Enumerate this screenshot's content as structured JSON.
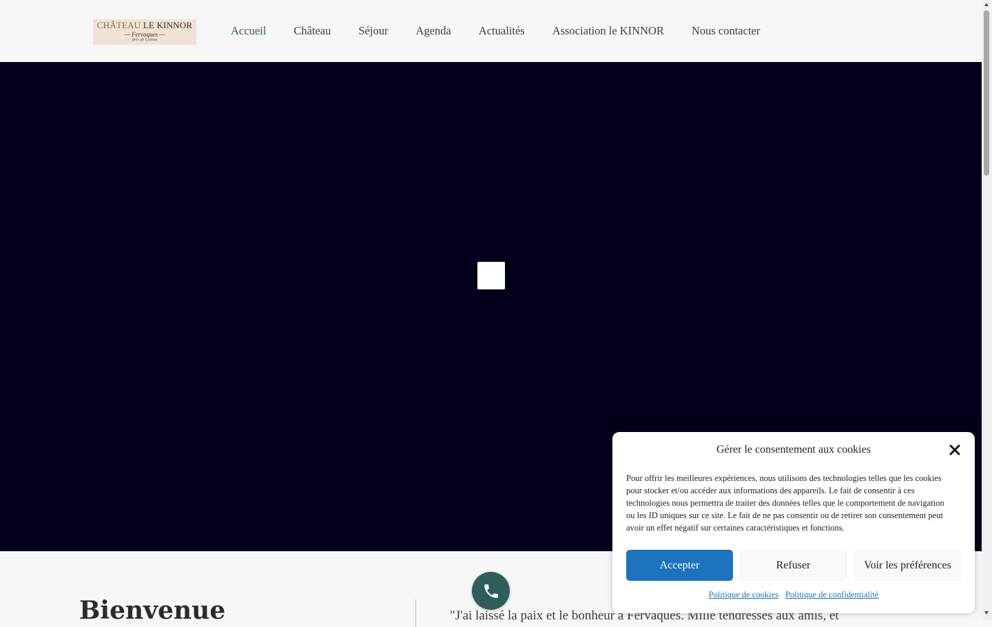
{
  "header": {
    "logo": {
      "line1_light": "CHÂTEAU",
      "line1_dark": "LE KINNOR",
      "line2": "Fervaques",
      "line3": "près de Lisieux"
    },
    "nav": [
      {
        "label": "Accueil",
        "active": true
      },
      {
        "label": "Château",
        "active": false
      },
      {
        "label": "Séjour",
        "active": false
      },
      {
        "label": "Agenda",
        "active": false
      },
      {
        "label": "Actualités",
        "active": false
      },
      {
        "label": "Association le KINNOR",
        "active": false
      },
      {
        "label": "Nous contacter",
        "active": false
      }
    ]
  },
  "hero": {
    "background": "#00001a",
    "play_icon": "video-play-icon"
  },
  "content": {
    "welcome_title": "Bienvenue",
    "quote": "\"J'ai laissé la paix et le bonheur à Fervaques. Mille tendresses aux amis, et"
  },
  "phone_button": {
    "icon": "phone-icon",
    "color": "#2f5d5c"
  },
  "cookie_banner": {
    "title": "Gérer le consentement aux cookies",
    "close_icon": "close-icon",
    "text": "Pour offrir les meilleures expériences, nous utilisons des technologies telles que les cookies pour stocker et/ou accéder aux informations des appareils. Le fait de consentir à ces technologies nous permettra de traiter des données telles que le comportement de navigation ou les ID uniques sur ce site. Le fait de ne pas consentir ou de retirer son consentement peut avoir un effet négatif sur certaines caractéristiques et fonctions.",
    "accept_label": "Accepter",
    "refuse_label": "Refuser",
    "preferences_label": "Voir les préférences",
    "cookie_policy_link": "Politique de cookies",
    "privacy_policy_link": "Politique de confidentialité",
    "accent_color": "#1e73be"
  },
  "colors": {
    "brand": "#2f5d5c",
    "page_background": "#f7f7f7"
  }
}
